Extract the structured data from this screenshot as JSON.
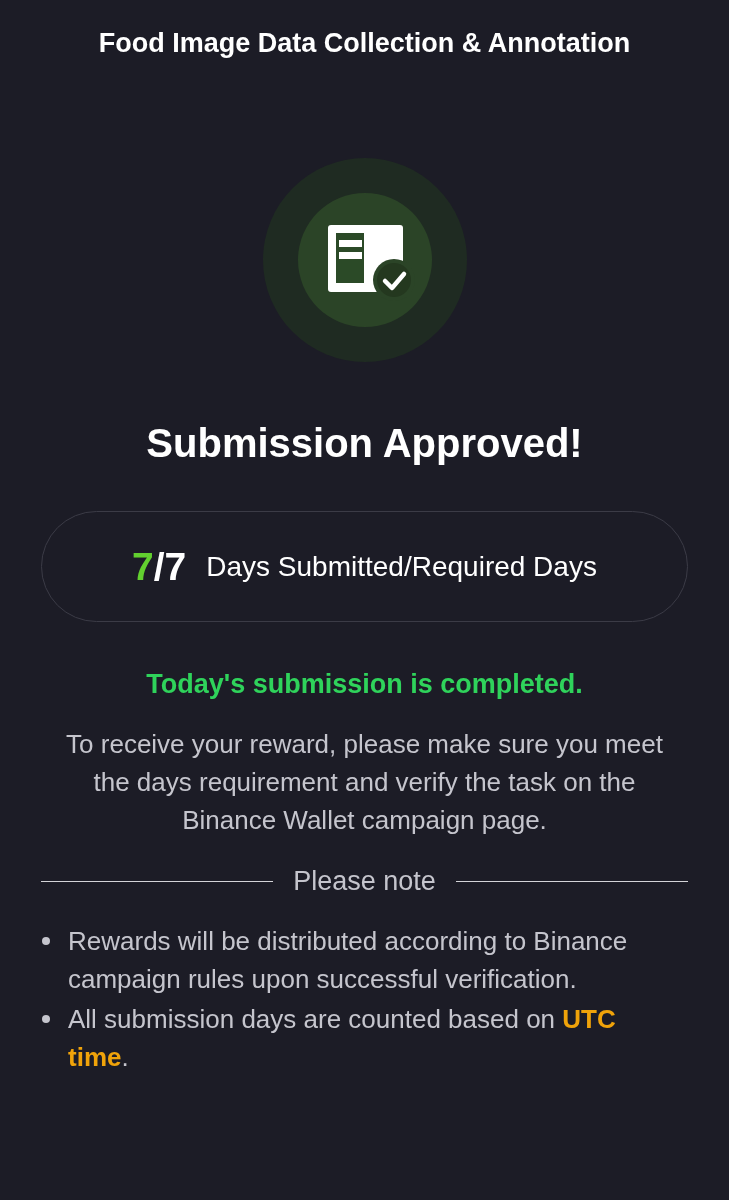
{
  "header": {
    "title": "Food Image Data Collection & Annotation"
  },
  "status": {
    "heading": "Submission Approved!"
  },
  "progress": {
    "submitted": "7",
    "required": "/7",
    "label": "Days Submitted/Required Days"
  },
  "message": "Today's submission is completed.",
  "instructions": "To receive your reward, please make sure you meet the days requirement and verify the task on the Binance Wallet campaign page.",
  "notes": {
    "heading": "Please note",
    "items": [
      "Rewards will be distributed according to Binance campaign rules upon successful verification.",
      "All submission days are counted based on **UTC time**."
    ]
  }
}
